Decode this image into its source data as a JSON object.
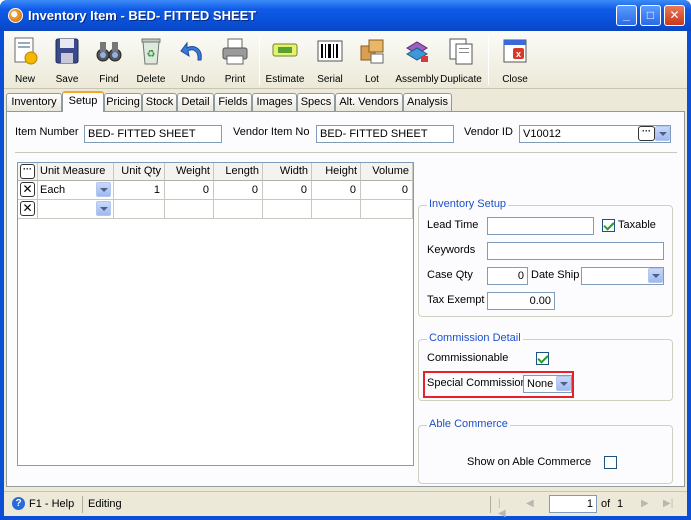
{
  "window": {
    "title": "Inventory Item - BED- FITTED SHEET"
  },
  "toolbar": {
    "new": "New",
    "save": "Save",
    "find": "Find",
    "delete": "Delete",
    "undo": "Undo",
    "print": "Print",
    "estimate": "Estimate",
    "serial": "Serial",
    "lot": "Lot",
    "assembly": "Assembly",
    "duplicate": "Duplicate",
    "close": "Close"
  },
  "tabs": [
    "Inventory",
    "Setup",
    "Pricing",
    "Stock",
    "Detail",
    "Fields",
    "Images",
    "Specs",
    "Alt. Vendors",
    "Analysis"
  ],
  "header": {
    "item_number_label": "Item Number",
    "item_number": "BED- FITTED SHEET",
    "vendor_item_no_label": "Vendor Item No",
    "vendor_item_no": "BED- FITTED SHEET",
    "vendor_id_label": "Vendor ID",
    "vendor_id": "V10012"
  },
  "grid": {
    "columns": [
      "Unit Measure",
      "Unit Qty",
      "Weight",
      "Length",
      "Width",
      "Height",
      "Volume"
    ],
    "rows": [
      {
        "unit": "Each",
        "qty": "1",
        "weight": "0",
        "length": "0",
        "width": "0",
        "height": "0",
        "volume": "0"
      }
    ]
  },
  "inventory_setup": {
    "title": "Inventory Setup",
    "lead_time_label": "Lead Time",
    "lead_time": "",
    "taxable_label": "Taxable",
    "keywords_label": "Keywords",
    "keywords": "",
    "case_qty_label": "Case Qty",
    "case_qty": "0",
    "date_ship_label": "Date Ship",
    "date_ship": "",
    "tax_exempt_label": "Tax Exempt",
    "tax_exempt": "0.00"
  },
  "commission": {
    "title": "Commission Detail",
    "commissionable_label": "Commissionable",
    "special_label": "Special Commission",
    "special_value": "None"
  },
  "able": {
    "title": "Able Commerce",
    "show_label": "Show on Able Commerce"
  },
  "status": {
    "help": "F1 - Help",
    "mode": "Editing",
    "page": "1",
    "of_label": "of",
    "total": "1"
  },
  "colors": {
    "title_bar": "#0f5be8",
    "highlight": "#e8202a",
    "group_title": "#1c50c8"
  }
}
